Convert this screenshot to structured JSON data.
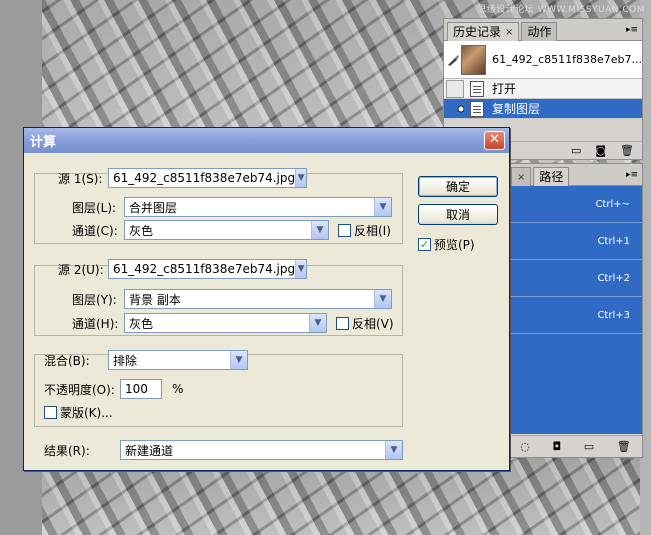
{
  "watermark": "思缘设计论坛 WWW.MISSYUAN.COM",
  "history_panel": {
    "tabs": [
      {
        "label": "历史记录",
        "close": "×"
      },
      {
        "label": "动作"
      }
    ],
    "menu_icon": "▸≡",
    "snapshot": {
      "name": "61_492_c8511f838e7eb7..."
    },
    "items": [
      {
        "label": "打开",
        "selected": false
      },
      {
        "label": "复制图层",
        "selected": true
      }
    ]
  },
  "channels_panel": {
    "tabs": [
      {
        "label": "×"
      },
      {
        "label": "路径"
      }
    ],
    "menu_icon": "▸≡",
    "shortcuts": [
      "Ctrl+~",
      "Ctrl+1",
      "Ctrl+2",
      "Ctrl+3"
    ]
  },
  "dialog": {
    "title": "计算",
    "close": "✕",
    "source1": {
      "label": "源 1(S):",
      "file": "61_492_c8511f838e7eb74.jpg",
      "layer_label": "图层(L):",
      "layer": "合并图层",
      "channel_label": "通道(C):",
      "channel": "灰色",
      "invert_label": "反相(I)",
      "invert": false
    },
    "source2": {
      "label": "源 2(U):",
      "file": "61_492_c8511f838e7eb74.jpg",
      "layer_label": "图层(Y):",
      "layer": "背景 副本",
      "channel_label": "通道(H):",
      "channel": "灰色",
      "invert_label": "反相(V)",
      "invert": false
    },
    "blend": {
      "label": "混合(B):",
      "mode": "排除",
      "opacity_label": "不透明度(O):",
      "opacity": "100",
      "opacity_unit": "%",
      "mask_label": "蒙版(K)...",
      "mask": false
    },
    "result": {
      "label": "结果(R):",
      "value": "新建通道"
    },
    "ok_label": "确定",
    "cancel_label": "取消",
    "preview_label": "预览(P)",
    "preview": true
  }
}
